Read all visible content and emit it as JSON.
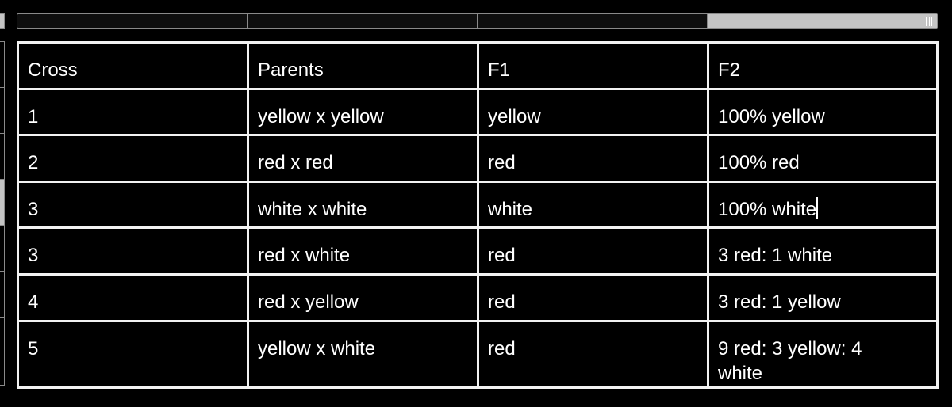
{
  "ruler": {
    "column_selected_index": 3,
    "row_selected_index": 3
  },
  "table": {
    "headers": [
      "Cross",
      "Parents",
      "F1",
      "F2"
    ],
    "rows": [
      [
        "1",
        "yellow x yellow",
        "yellow",
        "100% yellow"
      ],
      [
        "2",
        "red x red",
        "red",
        "100% red"
      ],
      [
        "3",
        "white x white",
        "white",
        "100% white"
      ],
      [
        "3",
        "red x white",
        "red",
        "3 red: 1 white"
      ],
      [
        "4",
        "red x yellow",
        "red",
        "3 red: 1 yellow"
      ],
      [
        "5",
        "yellow x white",
        "red",
        "9 red: 3 yellow: 4 white"
      ]
    ]
  },
  "cursor": {
    "row": 2,
    "col": 3
  },
  "colors": {
    "background": "#000000",
    "border": "#f2f2f2",
    "ruler_selected": "#c4c4c4",
    "text": "#ffffff"
  }
}
